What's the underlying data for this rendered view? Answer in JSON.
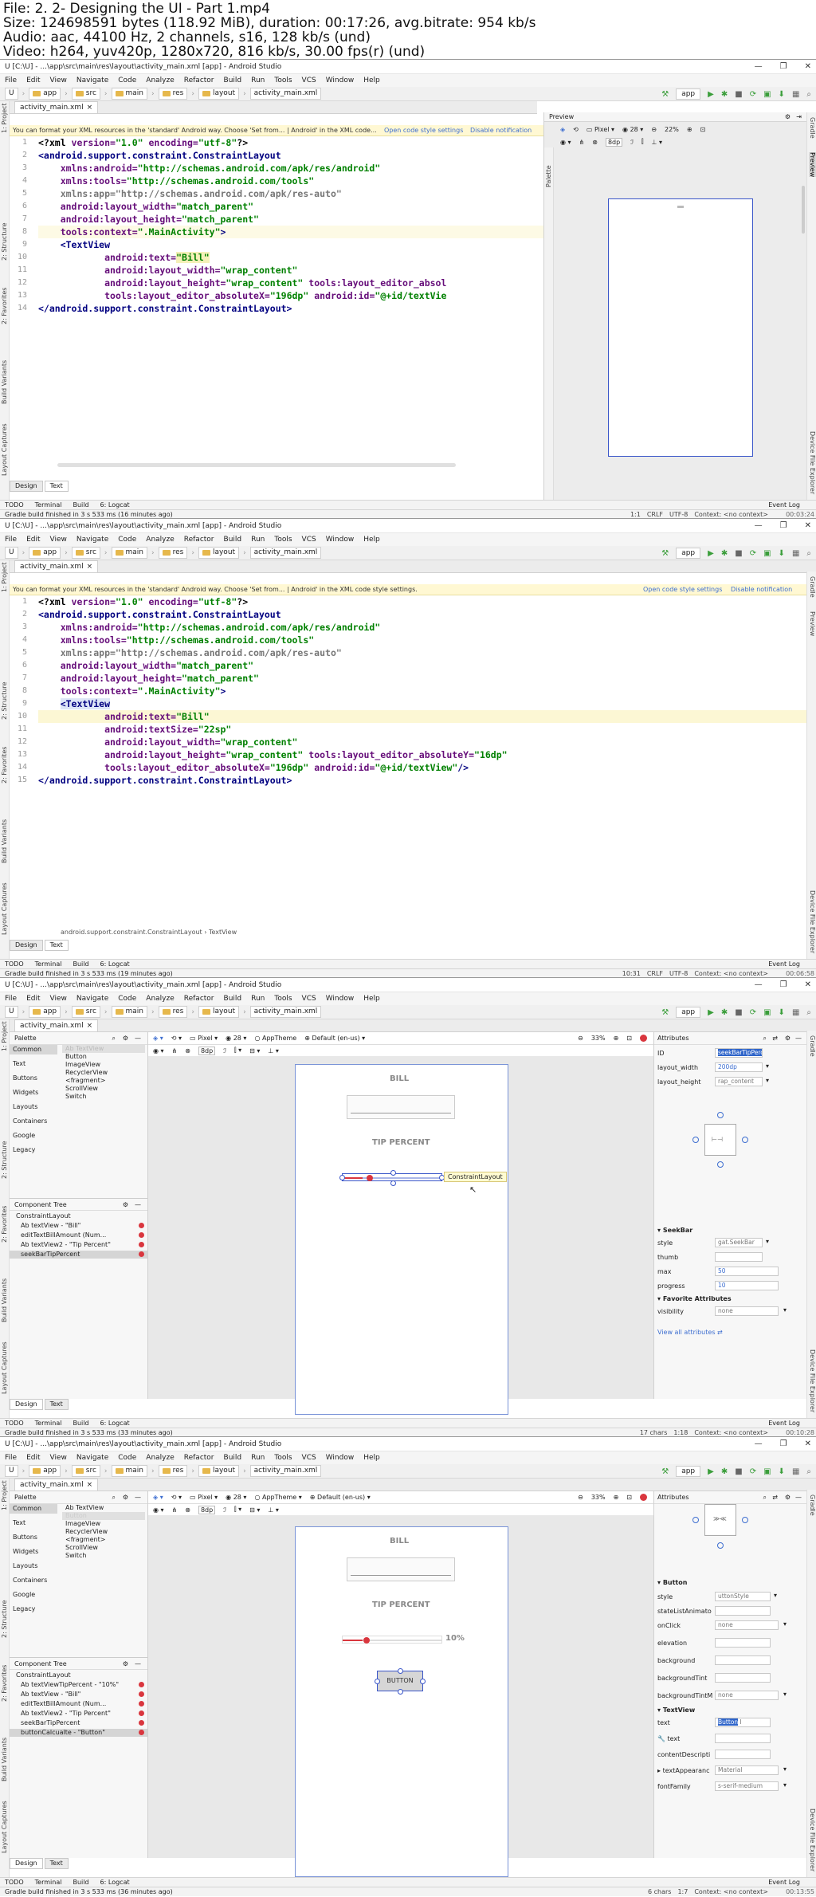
{
  "header": {
    "file": "File: 2. 2- Designing the UI - Part 1.mp4",
    "size": "Size: 124698591 bytes (118.92 MiB), duration: 00:17:26, avg.bitrate: 954 kb/s",
    "audio": "Audio: aac, 44100 Hz, 2 channels, s16, 128 kb/s (und)",
    "video": "Video: h264, yuv420p, 1280x720, 816 kb/s, 30.00 fps(r) (und)"
  },
  "common": {
    "title": "U [C:\\U] - ...\\app\\src\\main\\res\\layout\\activity_main.xml [app] - Android Studio",
    "menus": [
      "File",
      "Edit",
      "View",
      "Navigate",
      "Code",
      "Analyze",
      "Refactor",
      "Build",
      "Run",
      "Tools",
      "VCS",
      "Window",
      "Help"
    ],
    "crumbs": [
      "U",
      "app",
      "src",
      "main",
      "res",
      "layout",
      "activity_main.xml"
    ],
    "app_selector": "app",
    "file_tab": "activity_main.xml",
    "design_tab": "Design",
    "text_tab": "Text",
    "tool_tabs": [
      "TODO",
      "Terminal",
      "Build",
      "6: Logcat"
    ],
    "event_log": "Event Log",
    "left_strip": [
      "1: Project",
      "2: Structure",
      "2: Favorites",
      "Build Variants",
      "Layout Captures"
    ],
    "right_strip": [
      "Gradle",
      "Preview",
      "Device File Explorer"
    ],
    "notice": "You can format your XML resources in the 'standard' Android way. Choose 'Set from... | Android' in the XML code style settings.",
    "notice_short": "You can format your XML resources in the 'standard' Android way. Choose 'Set from... | Android' in the XML code...",
    "open_settings": "Open code style settings",
    "disable": "Disable notification"
  },
  "pane1": {
    "preview_title": "Preview",
    "device": "Pixel",
    "api": "28",
    "zoom": "22%",
    "dp": "8dp",
    "status": "Gradle build finished in 3 s 533 ms (16 minutes ago)",
    "pos": "1:1",
    "crlf": "CRLF",
    "enc": "UTF-8",
    "ctx": "Context: <no context>",
    "stamp": "00:03:24"
  },
  "pane2": {
    "path": [
      "android.support.constraint.ConstraintLayout",
      "TextView"
    ],
    "status": "Gradle build finished in 3 s 533 ms (19 minutes ago)",
    "pos": "10:31",
    "crlf": "CRLF",
    "enc": "UTF-8",
    "ctx": "Context: <no context>",
    "stamp": "00:06:58"
  },
  "pane3": {
    "palette": "Palette",
    "cats": [
      "Common",
      "Text",
      "Buttons",
      "Widgets",
      "Layouts",
      "Containers",
      "Google",
      "Legacy"
    ],
    "items": [
      "Ab TextView",
      "Button",
      "ImageView",
      "RecyclerView",
      "<fragment>",
      "ScrollView",
      "Switch"
    ],
    "tree_title": "Component Tree",
    "tree": [
      "ConstraintLayout",
      "Ab textView - \"Bill\"",
      "editTextBillAmount (Num...",
      "Ab textView2 - \"Tip Percent\"",
      "seekBarTipPercent"
    ],
    "device": "Pixel",
    "api": "28",
    "theme": "AppTheme",
    "locale": "Default (en-us)",
    "zoom": "33%",
    "dp": "8dp",
    "bill": "BILL",
    "tip": "TIP PERCENT",
    "tooltip": "ConstraintLayout",
    "attributes": "Attributes",
    "id_label": "ID",
    "id_value": "seekBarTipPercent",
    "lw_label": "layout_width",
    "lw_value": "200dp",
    "lh_label": "layout_height",
    "lh_value": "rap_content",
    "section": "SeekBar",
    "style_label": "style",
    "style_value": "gat.SeekBar",
    "thumb_label": "thumb",
    "max_label": "max",
    "max_value": "50",
    "progress_label": "progress",
    "progress_value": "10",
    "fav": "Favorite Attributes",
    "vis_label": "visibility",
    "vis_value": "none",
    "view_all": "View all attributes",
    "status": "Gradle build finished in 3 s 533 ms (33 minutes ago)",
    "chars": "17 chars",
    "pos": "1:18",
    "ctx": "Context: <no context>",
    "stamp": "00:10:28"
  },
  "pane4": {
    "tree": [
      "ConstraintLayout",
      "Ab textViewTipPercent - \"10%\"",
      "Ab textView - \"Bill\"",
      "editTextBillAmount (Num...",
      "Ab textView2 - \"Tip Percent\"",
      "seekBarTipPercent",
      "buttonCalcualte - \"Button\""
    ],
    "items": [
      "Ab TextView",
      "Button",
      "ImageView",
      "RecyclerView",
      "<fragment>",
      "ScrollView",
      "Switch"
    ],
    "bill": "BILL",
    "tip": "TIP PERCENT",
    "pct": "10%",
    "button": "BUTTON",
    "section": "Button",
    "rows": [
      [
        "style",
        "uttonStyle"
      ],
      [
        "stateListAnimato",
        ""
      ],
      [
        "onClick",
        "none"
      ],
      [
        "elevation",
        ""
      ],
      [
        "background",
        ""
      ],
      [
        "backgroundTint",
        ""
      ],
      [
        "backgroundTintM",
        "none"
      ]
    ],
    "tv_section": "TextView",
    "text_label": "text",
    "text_value": "Button",
    "text2_label": "text",
    "cd_label": "contentDescripti",
    "ta_label": "textAppearanc",
    "ta_value": "Material",
    "ff_label": "fontFamily",
    "ff_value": "s-serif-medium",
    "status": "Gradle build finished in 3 s 533 ms (36 minutes ago)",
    "chars": "6 chars",
    "pos": "1:7",
    "ctx": "Context: <no context>",
    "stamp": "00:13:55"
  }
}
